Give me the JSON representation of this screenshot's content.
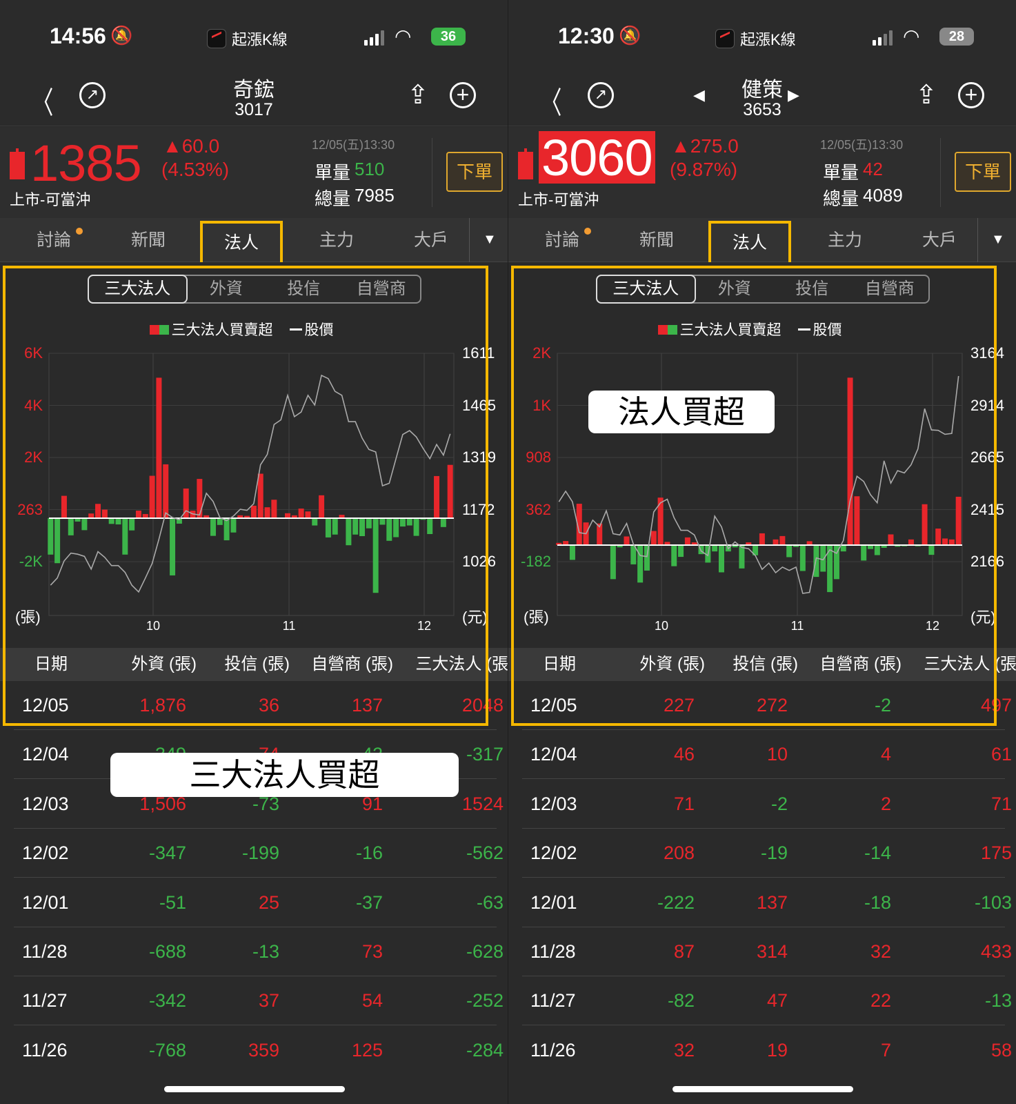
{
  "panels": [
    {
      "status": {
        "time": "14:56",
        "app": "起漲K線",
        "battery": "36",
        "battery_color": "#3cb54a"
      },
      "nav": {
        "name": "奇鋐",
        "code": "3017",
        "arrows": false
      },
      "quote": {
        "price": "1385",
        "price_highlight": false,
        "change": "▲60.0",
        "pct": "(4.53%)",
        "market": "上市-可當沖",
        "datetime": "12/05(五)13:30",
        "vol_label": "單量",
        "vol": "510",
        "vol_color": "#3cb54a",
        "total_label": "總量",
        "total": "7985",
        "order": "下單"
      },
      "tabs": [
        "討論",
        "新聞",
        "法人",
        "主力",
        "大戶"
      ],
      "active_tab": 2,
      "seg": [
        "三大法人",
        "外資",
        "投信",
        "自營商"
      ],
      "legend": {
        "bars": "三大法人買賣超",
        "line": "股價"
      },
      "chart_data": {
        "type": "bar+line",
        "left_ticks": [
          "6K",
          "4K",
          "2K",
          "263",
          "-2K"
        ],
        "left_tick_colors": [
          "r",
          "r",
          "r",
          "r",
          "g"
        ],
        "right_ticks": [
          "1611",
          "1465",
          "1319",
          "1172",
          "1026"
        ],
        "xticks": [
          "10",
          "11",
          "12"
        ],
        "left_unit": "(張)",
        "right_unit": "(元)",
        "bars_k": [
          -1.4,
          -1.73,
          0.86,
          -0.66,
          -0.13,
          -0.46,
          0.18,
          0.55,
          0.33,
          -0.22,
          -0.24,
          -1.4,
          -0.47,
          0.29,
          0.16,
          1.63,
          5.4,
          2.07,
          -2.2,
          -0.21,
          1.14,
          0.29,
          1.51,
          0.11,
          -0.68,
          -0.26,
          -0.85,
          -0.55,
          0.11,
          0.09,
          0.48,
          1.71,
          0.42,
          0.71,
          0,
          0.19,
          0.11,
          0.37,
          0.26,
          -0.28,
          0.88,
          -0.74,
          -0.63,
          0.13,
          -1.04,
          -0.63,
          -0.69,
          -0.39,
          -2.87,
          -0.25,
          -0.87,
          -0.73,
          -0.32,
          -0.28,
          -0.68,
          -0.06,
          -0.61,
          1.62,
          -0.34,
          2.05
        ],
        "price": [
          960,
          980,
          1028,
          1050,
          1047,
          1041,
          1005,
          1054,
          1038,
          1015,
          1015,
          996,
          960,
          941,
          980,
          1021,
          1089,
          1163,
          1150,
          1144,
          1169,
          1160,
          1157,
          1218,
          1195,
          1150,
          1141,
          1154,
          1173,
          1170,
          1189,
          1298,
          1327,
          1411,
          1424,
          1493,
          1433,
          1446,
          1493,
          1466,
          1549,
          1540,
          1504,
          1493,
          1419,
          1419,
          1373,
          1341,
          1334,
          1239,
          1246,
          1315,
          1383,
          1394,
          1376,
          1344,
          1315,
          1355,
          1325,
          1385
        ],
        "price_range": [
          1026,
          1611
        ]
      },
      "table": {
        "headers": [
          "日期",
          "外資 (張)",
          "投信 (張)",
          "自營商 (張)",
          "三大法人 (張)"
        ],
        "rows": [
          [
            "12/05",
            "1,876",
            "36",
            "137",
            "2048"
          ],
          [
            "12/04",
            "-349",
            "74",
            "-42",
            "-317"
          ],
          [
            "12/03",
            "1,506",
            "-73",
            "91",
            "1524"
          ],
          [
            "12/02",
            "-347",
            "-199",
            "-16",
            "-562"
          ],
          [
            "12/01",
            "-51",
            "25",
            "-37",
            "-63"
          ],
          [
            "11/28",
            "-688",
            "-13",
            "73",
            "-628"
          ],
          [
            "11/27",
            "-342",
            "37",
            "54",
            "-252"
          ],
          [
            "11/26",
            "-768",
            "359",
            "125",
            "-284"
          ]
        ]
      },
      "annotation": "三大法人買超"
    },
    {
      "status": {
        "time": "12:30",
        "app": "起漲K線",
        "battery": "28",
        "battery_color": "#888888"
      },
      "nav": {
        "name": "健策",
        "code": "3653",
        "arrows": true
      },
      "quote": {
        "price": "3060",
        "price_highlight": true,
        "change": "▲275.0",
        "pct": "(9.87%)",
        "market": "上市-可當沖",
        "datetime": "12/05(五)13:30",
        "vol_label": "單量",
        "vol": "42",
        "vol_color": "#e8262b",
        "total_label": "總量",
        "total": "4089",
        "order": "下單"
      },
      "tabs": [
        "討論",
        "新聞",
        "法人",
        "主力",
        "大戶"
      ],
      "active_tab": 2,
      "seg": [
        "三大法人",
        "外資",
        "投信",
        "自營商"
      ],
      "legend": {
        "bars": "三大法人買賣超",
        "line": "股價"
      },
      "chart_data": {
        "type": "bar+line",
        "left_ticks": [
          "2K",
          "1K",
          "908",
          "362",
          "-182"
        ],
        "left_tick_colors": [
          "r",
          "r",
          "r",
          "r",
          "g"
        ],
        "right_ticks": [
          "3164",
          "2914",
          "2665",
          "2415",
          "2166"
        ],
        "xticks": [
          "10",
          "11",
          "12"
        ],
        "left_unit": "(張)",
        "right_unit": "(元)",
        "bars": [
          23,
          42,
          -152,
          425,
          233,
          0,
          222,
          0,
          -350,
          -23,
          89,
          -198,
          -385,
          -262,
          145,
          488,
          33,
          -217,
          -121,
          79,
          28,
          -93,
          -180,
          -65,
          -280,
          -65,
          -23,
          -240,
          28,
          -105,
          121,
          7,
          58,
          93,
          -124,
          -19,
          -266,
          40,
          -327,
          -273,
          -483,
          -350,
          -65,
          1721,
          502,
          -159,
          -40,
          -103,
          -28,
          110,
          -16,
          -12,
          58,
          -12,
          420,
          -100,
          170,
          68,
          58,
          497
        ],
        "price": [
          2453,
          2503,
          2453,
          2305,
          2300,
          2365,
          2333,
          2410,
          2300,
          2294,
          2349,
          2250,
          2195,
          2190,
          2404,
          2448,
          2465,
          2377,
          2316,
          2316,
          2294,
          2217,
          2195,
          2384,
          2333,
          2228,
          2261,
          2234,
          2228,
          2195,
          2129,
          2159,
          2113,
          2140,
          2124,
          2140,
          2014,
          2019,
          2184,
          2175,
          2223,
          2206,
          2267,
          2459,
          2575,
          2550,
          2487,
          2448,
          2649,
          2542,
          2602,
          2591,
          2630,
          2706,
          2899,
          2797,
          2795,
          2776,
          2780,
          3055
        ],
        "price_range": [
          2166,
          3164
        ]
      },
      "table": {
        "headers": [
          "日期",
          "外資 (張)",
          "投信 (張)",
          "自營商 (張)",
          "三大法人 (張)"
        ],
        "rows": [
          [
            "12/05",
            "227",
            "272",
            "-2",
            "497"
          ],
          [
            "12/04",
            "46",
            "10",
            "4",
            "61"
          ],
          [
            "12/03",
            "71",
            "-2",
            "2",
            "71"
          ],
          [
            "12/02",
            "208",
            "-19",
            "-14",
            "175"
          ],
          [
            "12/01",
            "-222",
            "137",
            "-18",
            "-103"
          ],
          [
            "11/28",
            "87",
            "314",
            "32",
            "433"
          ],
          [
            "11/27",
            "-82",
            "47",
            "22",
            "-13"
          ],
          [
            "11/26",
            "32",
            "19",
            "7",
            "58"
          ]
        ]
      },
      "annotation": "法人買超"
    }
  ],
  "colors": {
    "up": "#e8262b",
    "down": "#3cb54a",
    "highlight": "#f5b800"
  }
}
